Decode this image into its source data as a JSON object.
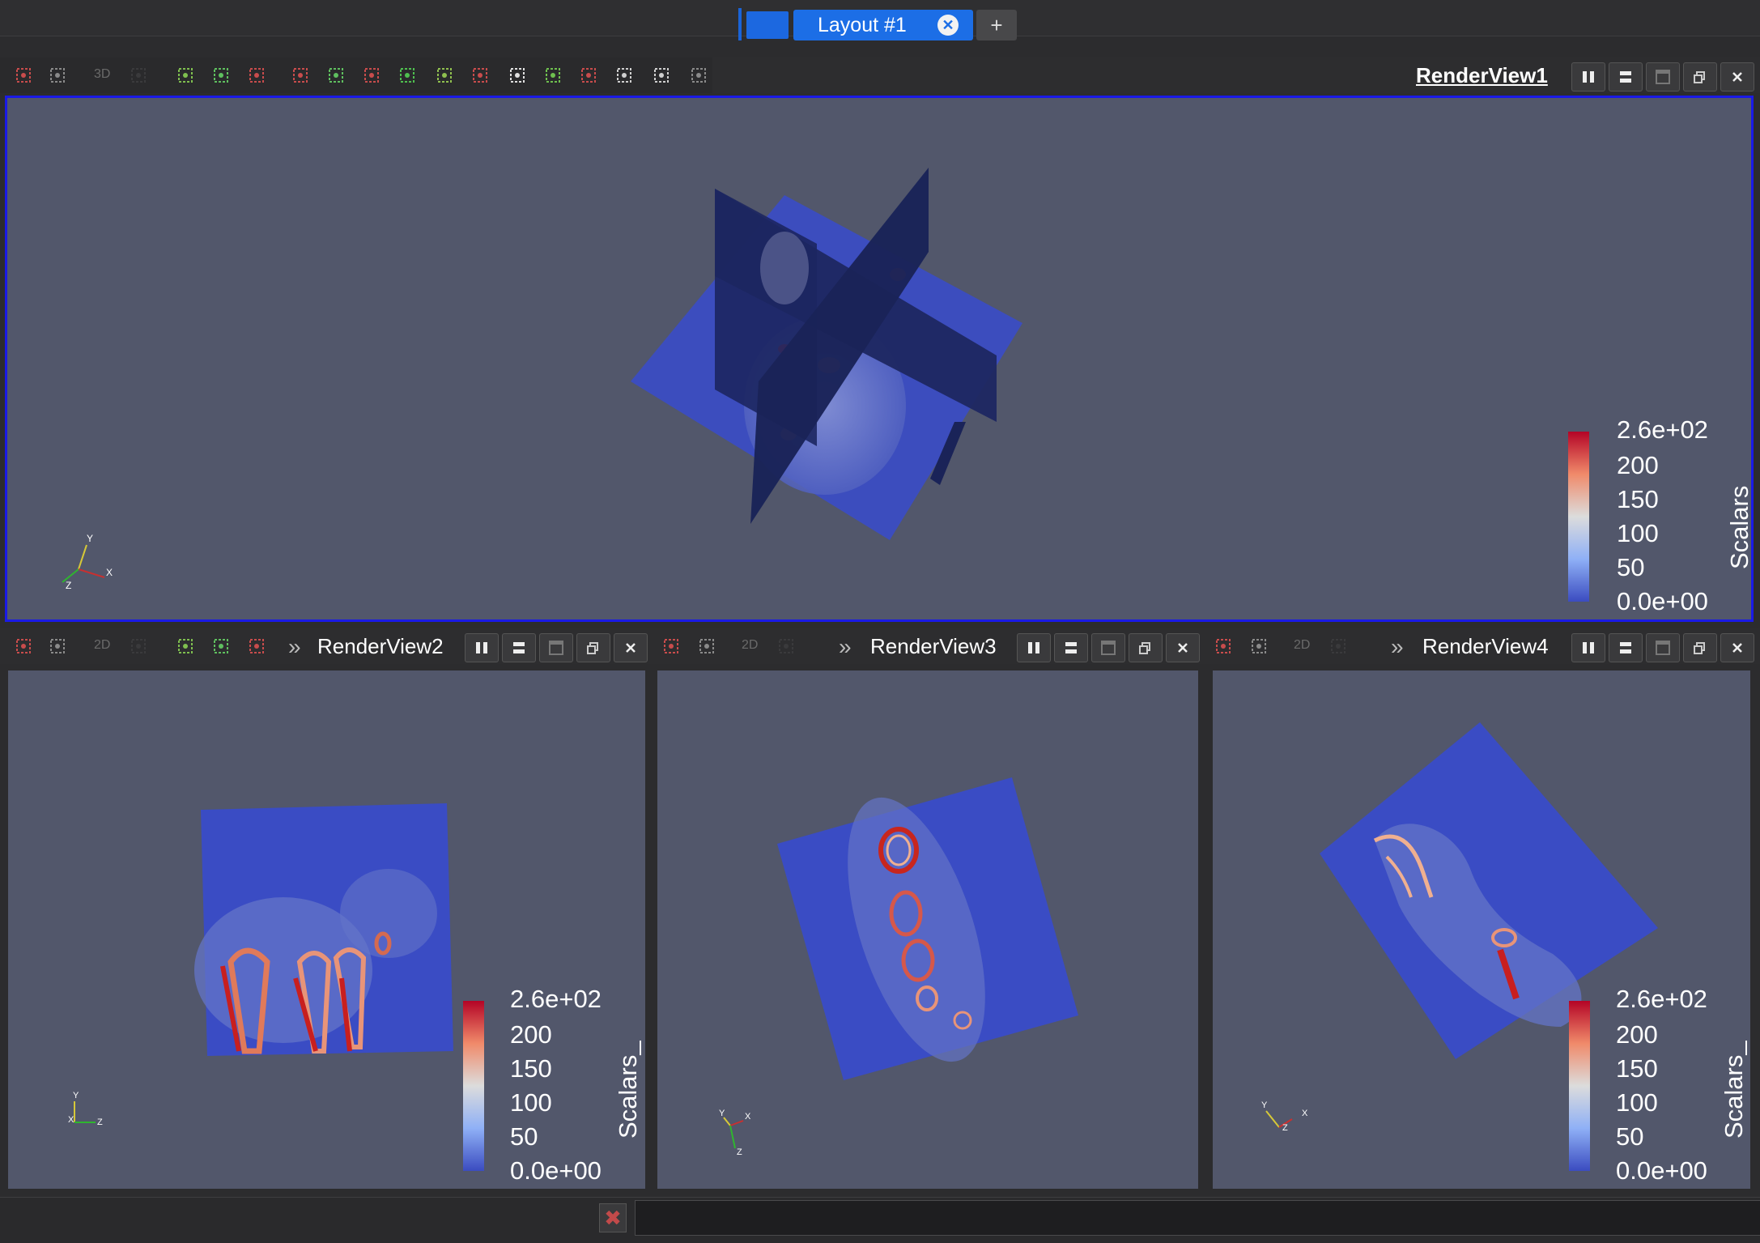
{
  "layout_tab": {
    "label": "Layout #1",
    "add_label": "+"
  },
  "views": {
    "rv1": {
      "title": "RenderView1",
      "mode": "3D"
    },
    "rv2": {
      "title": "RenderView2",
      "mode": "2D"
    },
    "rv3": {
      "title": "RenderView3",
      "mode": "2D"
    },
    "rv4": {
      "title": "RenderView4",
      "mode": "2D"
    }
  },
  "legend": {
    "title": "Scalars_",
    "labels": [
      "2.6e+02",
      "200",
      "150",
      "100",
      "50",
      "0.0e+00"
    ]
  },
  "axes": {
    "rv1": [
      "Y",
      "X",
      "Z"
    ],
    "rv2": [
      "Y",
      "X",
      "Z"
    ],
    "rv3": [
      "Y",
      "X",
      "Z"
    ],
    "rv4": [
      "Y",
      "X",
      "Z"
    ]
  },
  "colors": {
    "view_bg": "#52576b",
    "active_border": "#1a1ae6",
    "slice_blue": "#3448b4",
    "accent": "#1c6ee6"
  },
  "icons": {
    "toolbar": [
      "reset-camera-icon",
      "zoom-to-data-icon",
      "toggle-3d-icon",
      "capture-screenshot-icon",
      "select-cells-on-icon",
      "select-points-on-icon",
      "select-cells-through-icon",
      "select-points-through-icon",
      "select-cells-polygon-icon",
      "select-points-polygon-icon",
      "select-blocks-icon",
      "interactive-select-cells-icon",
      "interactive-select-points-icon",
      "hover-points-icon",
      "hover-cells-icon",
      "grow-selection-icon",
      "shrink-selection-icon",
      "clear-selection-icon"
    ],
    "view_controls": [
      "split-horizontal-icon",
      "split-vertical-icon",
      "maximize-icon",
      "restore-icon",
      "close-icon"
    ]
  }
}
